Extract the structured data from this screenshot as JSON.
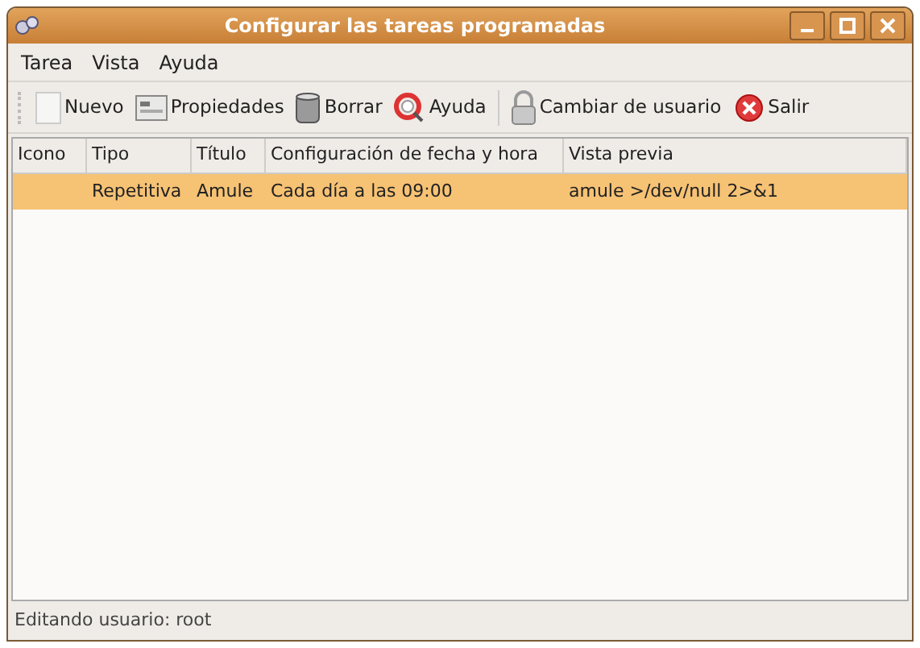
{
  "window": {
    "title": "Configurar las tareas programadas"
  },
  "menu": [
    "Tarea",
    "Vista",
    "Ayuda"
  ],
  "toolbar": [
    {
      "kind": "new",
      "label": "Nuevo"
    },
    {
      "kind": "properties",
      "label": "Propiedades"
    },
    {
      "kind": "delete",
      "label": "Borrar"
    },
    {
      "kind": "help",
      "label": "Ayuda"
    },
    {
      "kind": "separator"
    },
    {
      "kind": "user",
      "label": "Cambiar de usuario"
    },
    {
      "kind": "quit",
      "label": "Salir"
    }
  ],
  "table": {
    "columns": [
      "Icono",
      "Tipo",
      "Título",
      "Configuración de fecha y hora",
      "Vista previa"
    ],
    "rows": [
      {
        "selected": true,
        "cells": [
          "",
          "Repetitiva",
          "Amule",
          "Cada día a las 09:00",
          "amule >/dev/null 2>&1"
        ]
      }
    ]
  },
  "status_bar": "Editando usuario: root"
}
